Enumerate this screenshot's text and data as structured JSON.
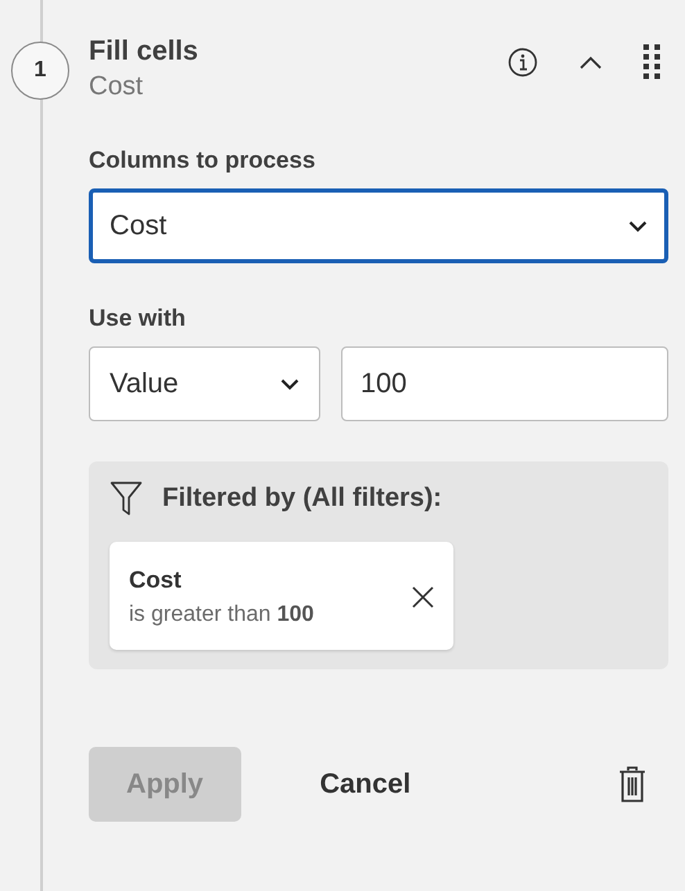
{
  "step": {
    "number": "1",
    "title": "Fill cells",
    "subtitle": "Cost"
  },
  "columns_field": {
    "label": "Columns to process",
    "value": "Cost",
    "focused": true
  },
  "use_with": {
    "label": "Use with",
    "mode": "Value",
    "value": "100"
  },
  "filter_panel": {
    "title": "Filtered by (All filters):",
    "filters": [
      {
        "column": "Cost",
        "condition": "is greater than **100**"
      }
    ]
  },
  "buttons": [
    {
      "label": "Apply",
      "kind": "primary",
      "disabled": true
    },
    {
      "label": "Cancel",
      "kind": "secondary",
      "disabled": false
    }
  ]
}
